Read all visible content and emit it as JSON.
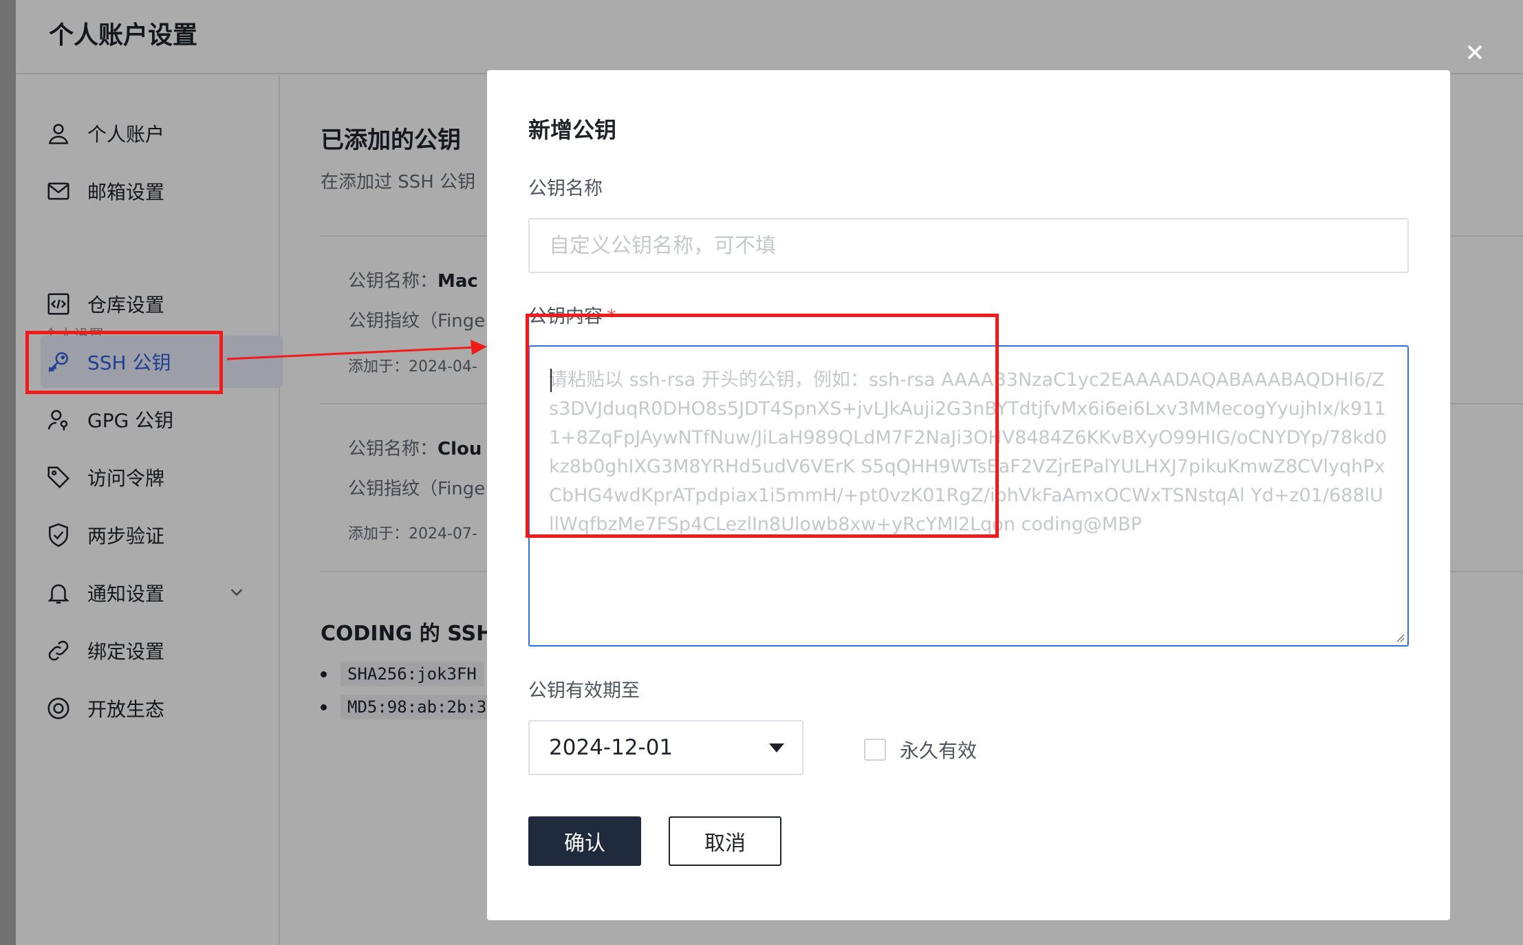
{
  "page": {
    "title": "个人账户设置"
  },
  "sidebar": {
    "group_label": "个人设置",
    "items": [
      {
        "label": "个人账户"
      },
      {
        "label": "邮箱设置"
      },
      {
        "label": "仓库设置"
      },
      {
        "label": "SSH 公钥"
      },
      {
        "label": "GPG 公钥"
      },
      {
        "label": "访问令牌"
      },
      {
        "label": "两步验证"
      },
      {
        "label": "通知设置"
      },
      {
        "label": "绑定设置"
      },
      {
        "label": "开放生态"
      }
    ],
    "active_item": "SSH 公钥"
  },
  "content": {
    "heading": "已添加的公钥",
    "description": "在添加过 SSH 公钥",
    "keys": [
      {
        "name_label": "公钥名称：",
        "name_value": "Mac",
        "fingerprint_label": "公钥指纹（Finge",
        "added": "添加于：2024-04-"
      },
      {
        "name_label": "公钥名称：",
        "name_value": "Clou",
        "fingerprint_label": "公钥指纹（Finge",
        "added": "添加于：2024-07-"
      }
    ],
    "coding_heading": "CODING 的 SSH",
    "fingerprints": [
      "SHA256:jok3FH",
      "MD5:98:ab:2b:3"
    ]
  },
  "modal": {
    "title": "新增公钥",
    "name_label": "公钥名称",
    "name_placeholder": "自定义公钥名称，可不填",
    "content_label": "公钥内容",
    "required_mark": "*",
    "content_placeholder": "请粘贴以 ssh-rsa 开头的公钥，例如：ssh-rsa AAAAB3NzaC1yc2EAAAADAQABAAABAQDHl6/Zs3DVJduqR0DHO8s5JDT4SpnXS+jvLJkAuji2G3nBYTdtjfvMx6i6ei6Lxv3MMecogYyujhIx/k9111+8ZqFpJAywNTfNuw/JiLaH989QLdM7F2NaJi3OHV8484Z6KKvBXyO99HIG/oCNYDYp/78kd0kz8b0ghIXG3M8YRHd5udV6VErK S5qQHH9WTsEaF2VZjrEPalYULHXJ7pikuKmwZ8CVlyqhPxCbHG4wdKprATpdpiax1i5mmH/+pt0vzK01RgZ/ibhVkFaAmxOCWxTSNstqAl Yd+z01/688lUllWqfbzMe7FSp4CLezlIn8Ulowb8xw+yRcYMl2Lqon coding@MBP",
    "expiry_label": "公钥有效期至",
    "expiry_value": "2024-12-01",
    "permanent_label": "永久有效",
    "confirm_label": "确认",
    "cancel_label": "取消"
  },
  "colors": {
    "annotation": "#f21b1b",
    "primary_button": "#1f2b3d",
    "active_sidebar": "#2f5fd8",
    "focus_border": "#2f6fe4"
  }
}
